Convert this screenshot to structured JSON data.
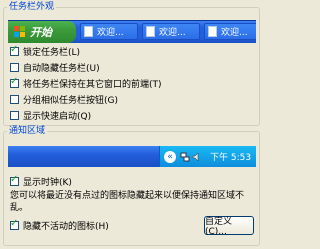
{
  "taskbar_group": {
    "title": "任务栏外观",
    "preview": {
      "start_label": "开始",
      "tasks": [
        "欢迎...",
        "欢迎...",
        "欢迎..."
      ]
    },
    "options": [
      {
        "label": "锁定任务栏(L)",
        "checked": true
      },
      {
        "label": "自动隐藏任务栏(U)",
        "checked": false
      },
      {
        "label": "将任务栏保持在其它窗口的前端(T)",
        "checked": true
      },
      {
        "label": "分组相似任务栏按钮(G)",
        "checked": false
      },
      {
        "label": "显示快速启动(Q)",
        "checked": false
      }
    ]
  },
  "tray_group": {
    "title": "通知区域",
    "preview": {
      "chevron": "«",
      "clock": "下午 5:53"
    },
    "show_clock": {
      "label": "显示时钟(K)",
      "checked": true
    },
    "info": "您可以将最近没有点过的图标隐藏起来以便保持通知区域不乱。",
    "hide_inactive": {
      "label": "隐藏不活动的图标(H)",
      "checked": true
    },
    "customize_label": "自定义(C)..."
  },
  "colors": {
    "dialog_bg": "#ece9d8",
    "group_title": "#0046d5",
    "taskbar_blue": "#245edb",
    "start_green": "#3c9b3c",
    "tray_blue": "#0e8ddc"
  }
}
